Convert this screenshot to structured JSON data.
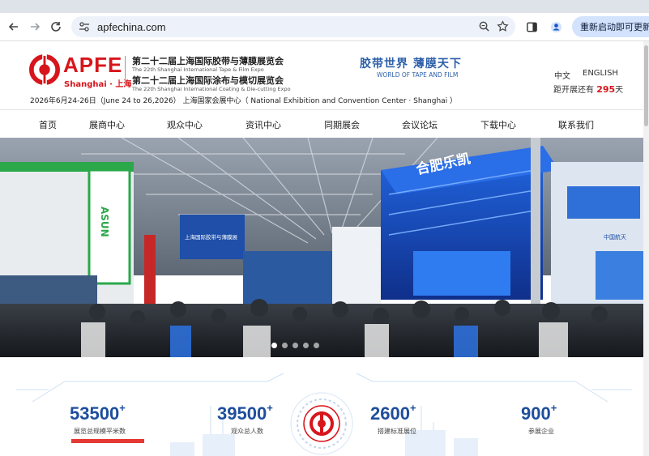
{
  "browser": {
    "url": "apfechina.com",
    "restart_label": "重新启动即可更新",
    "icons": {
      "back": "back-arrow-icon",
      "forward": "forward-arrow-icon",
      "reload": "reload-icon",
      "site_info": "site-settings-icon",
      "zoom": "zoom-icon",
      "bookmark": "star-icon",
      "sidepanel": "side-panel-icon",
      "profile": "profile-icon",
      "menu": "more-menu-icon"
    }
  },
  "header": {
    "logo_text": "APFE",
    "logo_sub": "Shanghai · 上海",
    "expo1_cn": "第二十二届上海国际胶带与薄膜展览会",
    "expo1_en": "The 22th Shanghai International Tape & Film Expo",
    "expo2_cn": "第二十二届上海国际涂布与模切展览会",
    "expo2_en": "The 22th Shanghai International Coating & Die-cutting Expo",
    "slogan_cn": "胶带世界  薄膜天下",
    "slogan_en": "WORLD OF TAPE AND FILM",
    "lang_cn": "中文",
    "lang_en": "ENGLISH",
    "countdown_prefix": "距开展还有",
    "countdown_days": "295",
    "countdown_suffix": "天",
    "date_line": "2026年6月24-26日（June 24 to 26,2026）  上海国家会展中心（ National Exhibition and Convention Center · Shanghai ）"
  },
  "nav": {
    "items": [
      "首页",
      "展商中心",
      "观众中心",
      "资讯中心",
      "同期展会",
      "会议论坛",
      "下载中心",
      "联系我们"
    ]
  },
  "hero": {
    "banner_text": "上海国际胶带与薄膜展",
    "booth_text": "合肥乐凯",
    "booth_text2": "中国航天",
    "sign_asun": "ASUN"
  },
  "stats": [
    {
      "value": "53500",
      "plus": "+",
      "label": "展览总规模平米数"
    },
    {
      "value": "39500",
      "plus": "+",
      "label": "观众总人数"
    },
    {
      "value": "2600",
      "plus": "+",
      "label": "搭建标准展位"
    },
    {
      "value": "900",
      "plus": "+",
      "label": "参展企业"
    }
  ],
  "colors": {
    "brand_red": "#d7151c",
    "brand_blue": "#1e4e9d",
    "slogan_blue": "#2d5fa8"
  }
}
